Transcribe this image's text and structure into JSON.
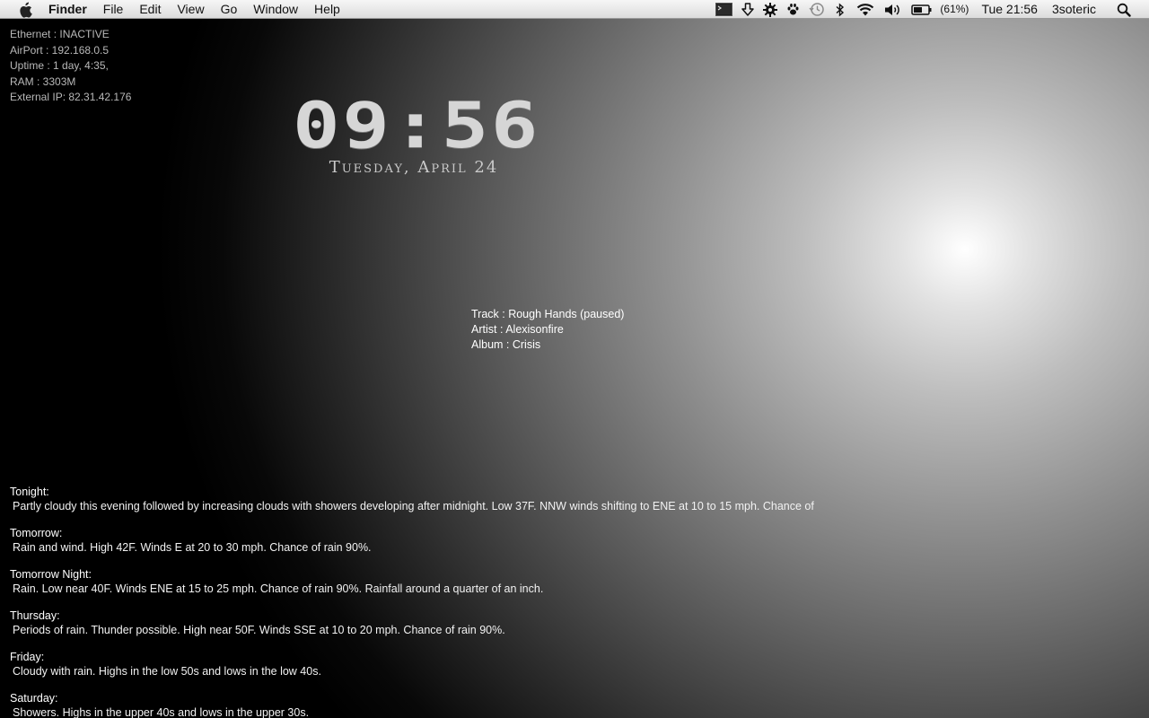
{
  "menubar": {
    "app_name": "Finder",
    "menus": [
      "File",
      "Edit",
      "View",
      "Go",
      "Window",
      "Help"
    ],
    "battery_percent": "(61%)",
    "clock": "Tue 21:56",
    "user": "3soteric"
  },
  "sysinfo": {
    "ethernet": "Ethernet : INACTIVE",
    "airport": "AirPort  : 192.168.0.5",
    "uptime": "Uptime : 1 day, 4:35,",
    "ram": "RAM : 3303M",
    "external_ip": "External IP: 82.31.42.176"
  },
  "clock": {
    "time": "09:56",
    "date": "Tuesday, April 24"
  },
  "nowplaying": {
    "track": "Track  : Rough Hands (paused)",
    "artist": "Artist : Alexisonfire",
    "album": "Album  : Crisis"
  },
  "forecast": [
    {
      "name": "Tonight:",
      "text": " Partly cloudy this evening followed by increasing clouds with showers developing after midnight. Low 37F. NNW winds shifting to ENE at 10 to 15 mph. Chance of"
    },
    {
      "name": "Tomorrow:",
      "text": " Rain and wind. High 42F. Winds E at 20 to 30 mph. Chance of rain 90%."
    },
    {
      "name": "Tomorrow Night:",
      "text": " Rain. Low near 40F. Winds ENE at 15 to 25 mph. Chance of rain 90%. Rainfall around a quarter of an inch."
    },
    {
      "name": "Thursday:",
      "text": " Periods of rain. Thunder possible. High near 50F. Winds SSE at 10 to 20 mph. Chance of rain 90%."
    },
    {
      "name": "Friday:",
      "text": " Cloudy with rain. Highs in the low 50s and lows in the low 40s."
    },
    {
      "name": "Saturday:",
      "text": " Showers. Highs in the upper 40s and lows in the upper 30s."
    }
  ],
  "icons": {
    "apple": "apple-icon",
    "terminal": "terminal-icon",
    "download": "download-arrow-icon",
    "gear": "gear-icon",
    "paw": "paw-icon",
    "timemachine": "time-machine-icon",
    "bluetooth": "bluetooth-icon",
    "wifi": "wifi-icon",
    "volume": "volume-icon",
    "battery": "battery-icon",
    "spotlight": "spotlight-search-icon"
  }
}
